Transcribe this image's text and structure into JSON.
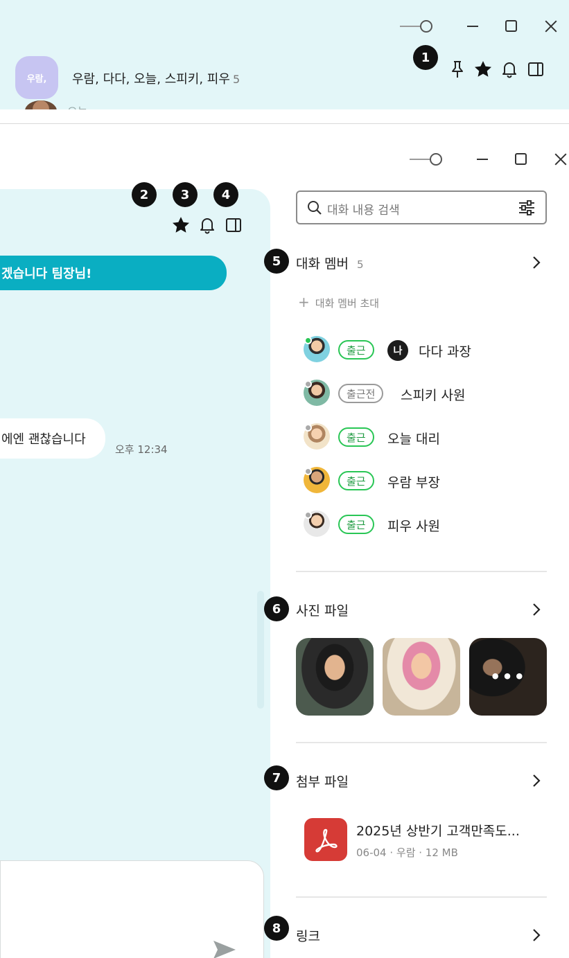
{
  "top_window": {
    "group_avatar_label": "우람,",
    "chat_title": "우람, 다다, 오늘, 스피키, 피우",
    "member_count": "5",
    "partial_preview_text": "오늘"
  },
  "markers": [
    "1",
    "2",
    "3",
    "4",
    "5",
    "6",
    "7",
    "8"
  ],
  "chat": {
    "teal_message": "겠습니다 팀장님!",
    "white_message": "에엔 괜찮습니다",
    "white_message_time": "오후 12:34"
  },
  "side_panel": {
    "search_placeholder": "대화 내용 검색",
    "members_section": {
      "title": "대화 멤버",
      "count": "5",
      "invite_label": "대화 멤버 초대",
      "me_label": "나",
      "members": [
        {
          "name": "다다 과장",
          "status": "출근",
          "online": true,
          "is_me": true
        },
        {
          "name": "스피키 사원",
          "status": "출근전",
          "online": false,
          "is_me": false
        },
        {
          "name": "오늘 대리",
          "status": "출근",
          "online": false,
          "is_me": false
        },
        {
          "name": "우람 부장",
          "status": "출근",
          "online": false,
          "is_me": false
        },
        {
          "name": "피우 사원",
          "status": "출근",
          "online": false,
          "is_me": false
        }
      ]
    },
    "photos_section": {
      "title": "사진 파일",
      "more_label": "•••"
    },
    "files_section": {
      "title": "첨부 파일",
      "file_name": "2025년 상반기 고객만족도...",
      "file_meta": "06-04 · 우람 · 12 MB"
    },
    "links_section": {
      "title": "링크"
    }
  },
  "colors": {
    "chat_background": "#e3f6f8",
    "accent_teal": "#0aaec2",
    "online_green": "#29c655",
    "pdf_red": "#d63b36"
  },
  "icons": [
    "slider-icon",
    "minimize-icon",
    "maximize-icon",
    "close-icon",
    "pin-icon",
    "star-icon",
    "bell-icon",
    "side-panel-icon",
    "search-icon",
    "filter-icon",
    "chevron-right-icon",
    "plus-icon",
    "pdf-icon",
    "send-icon"
  ]
}
